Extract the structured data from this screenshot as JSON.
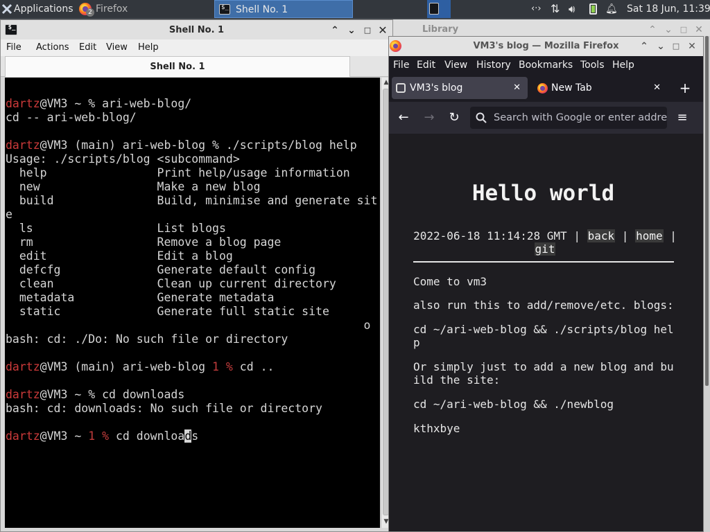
{
  "panel": {
    "applications_label": "Applications",
    "firefox_task_label": "Firefox",
    "firefox_task_count": "2",
    "shell_task_label": "Shell No. 1",
    "clock": "Sat 18 Jun, 11:39",
    "tray_icons": [
      "network-icon",
      "transfer-icon",
      "volume-icon",
      "battery-icon",
      "notification-bell-icon"
    ]
  },
  "shell_window": {
    "title": "Shell No. 1",
    "menu": [
      "File",
      "Actions",
      "Edit",
      "View",
      "Help"
    ],
    "tab_label": "Shell No. 1",
    "terminal_lines": [
      {
        "prompt_user": "",
        "text": ""
      },
      {
        "prompt_user": "dartz",
        "text": "@VM3 ~ % ari-web-blog/"
      },
      {
        "prompt_user": "",
        "text": "cd -- ari-web-blog/"
      },
      {
        "prompt_user": "",
        "text": ""
      },
      {
        "prompt_user": "dartz",
        "text": "@VM3 (main) ari-web-blog % ./scripts/blog help"
      },
      {
        "prompt_user": "",
        "text": "Usage: ./scripts/blog <subcommand>"
      },
      {
        "prompt_user": "",
        "text": "  help                Print help/usage information"
      },
      {
        "prompt_user": "",
        "text": "  new                 Make a new blog"
      },
      {
        "prompt_user": "",
        "text": "  build               Build, minimise and generate sit"
      },
      {
        "prompt_user": "",
        "text": "e"
      },
      {
        "prompt_user": "",
        "text": "  ls                  List blogs"
      },
      {
        "prompt_user": "",
        "text": "  rm                  Remove a blog page"
      },
      {
        "prompt_user": "",
        "text": "  edit                Edit a blog"
      },
      {
        "prompt_user": "",
        "text": "  defcfg              Generate default config"
      },
      {
        "prompt_user": "",
        "text": "  clean               Clean up current directory"
      },
      {
        "prompt_user": "",
        "text": "  metadata            Generate metadata"
      },
      {
        "prompt_user": "",
        "text": "  static              Generate full static site"
      },
      {
        "prompt_user": "",
        "text": "                                                    o"
      },
      {
        "prompt_user": "",
        "text": "bash: cd: ./Do: No such file or directory"
      },
      {
        "prompt_user": "",
        "text": ""
      },
      {
        "prompt_user": "dartz",
        "text_a": "@VM3 (main) ari-web-blog ",
        "err": "1 %",
        "text_b": " cd .."
      },
      {
        "prompt_user": "",
        "text": ""
      },
      {
        "prompt_user": "dartz",
        "text": "@VM3 ~ % cd downloads"
      },
      {
        "prompt_user": "",
        "text": "bash: cd: downloads: No such file or directory"
      },
      {
        "prompt_user": "",
        "text": ""
      },
      {
        "prompt_user": "dartz",
        "text_a": "@VM3 ~ ",
        "err": "1 %",
        "text_b": " cd downloa",
        "cursor_char": "d",
        "after_cursor": "s"
      }
    ]
  },
  "library_window": {
    "title": "Library"
  },
  "firefox_window": {
    "title": "VM3's blog — Mozilla Firefox",
    "menu": [
      "File",
      "Edit",
      "View",
      "History",
      "Bookmarks",
      "Tools",
      "Help"
    ],
    "tabs": [
      {
        "label": "VM3's blog",
        "active": true
      },
      {
        "label": "New Tab",
        "active": false
      }
    ],
    "url_placeholder": "Search with Google or enter address",
    "page": {
      "heading": "Hello world",
      "date": "2022-06-18 11:14:28 GMT",
      "sep": "|",
      "link_back": "back",
      "link_home": "home",
      "link_git": "git",
      "p1": "Come to vm3",
      "p2": "also run this to add/remove/etc. blogs:",
      "p3a": "cd ~/ari-web-blog && ./scripts/blog hel",
      "p3b": "p",
      "p4a": "Or simply just to add a new blog and bu",
      "p4b": "ild the site:",
      "p5": "cd ~/ari-web-blog && ./newblog",
      "p6": "kthxbye"
    }
  }
}
